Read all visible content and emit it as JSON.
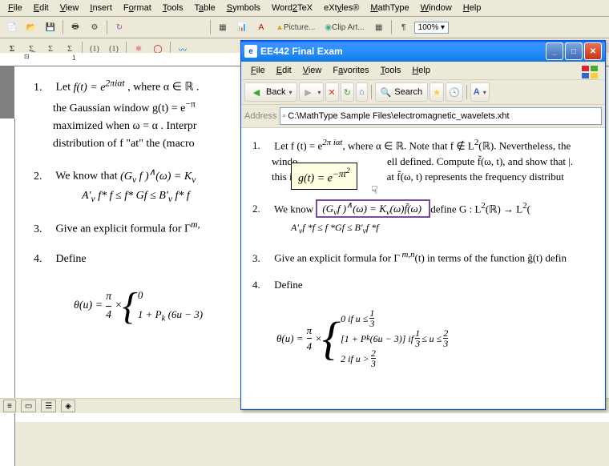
{
  "main_menu": {
    "file": "File",
    "edit": "Edit",
    "view": "View",
    "insert": "Insert",
    "format": "Format",
    "tools": "Tools",
    "table": "Table",
    "symbols": "Symbols",
    "word2tex": "Word2TeX",
    "extyles": "eXtyles",
    "mathtype": "MathType",
    "window": "Window",
    "help": "Help"
  },
  "main_toolbar": {
    "picture": "Picture...",
    "clipart": "Clip Art...",
    "zoom": "100%"
  },
  "doc": {
    "q1_num": "1.",
    "q1_text_a": "Let ",
    "q1_math_a": "f(t) = e",
    "q1_sup_a": "2πiαt",
    "q1_text_b": ", where α ∈ ℝ .",
    "q1_text_c": "the Gaussian window  g(t) = e",
    "q1_sup_c": "−π",
    "q1_text_d": "maximized when ω = α . Interpr",
    "q1_text_e": "distribution of  f  \"at\" the (macro",
    "q2_num": "2.",
    "q2_text_a": "We know that ",
    "q2_math_a": "(G",
    "q2_sub_a": "ν",
    "q2_math_b": " f )",
    "q2_sup_b": "∧",
    "q2_math_c": "(ω) = K",
    "q2_sub_c": "ν",
    "q2_line2": "A'",
    "q2_sub2": "ν",
    "q2_line2b": " f* f ≤ f* Gf ≤ B'",
    "q2_sub2c": "ν",
    "q2_line2c": " f* f",
    "q3_num": "3.",
    "q3_text": "Give an explicit formula for Γ",
    "q3_sup": "m,",
    "q4_num": "4.",
    "q4_text": "Define",
    "q4_eq_left": "θ(u) = ",
    "q4_eq_frac_num": "π",
    "q4_eq_frac_den": "4",
    "q4_eq_mid": " × ",
    "q4_eq_top": "0",
    "q4_eq_bot": "1 + P",
    "q4_eq_bot_sub": "k",
    "q4_eq_bot2": " (6u − 3)"
  },
  "popup": {
    "title": "EE442 Final Exam",
    "menu": {
      "file": "File",
      "edit": "Edit",
      "view": "View",
      "favorites": "Favorites",
      "tools": "Tools",
      "help": "Help"
    },
    "back": "Back",
    "search": "Search",
    "addr_label": "Address",
    "addr_value": "C:\\MathType Sample Files\\electromagnetic_wavelets.xht",
    "q1_num": "1.",
    "q1a": "Let f (t) = e",
    "q1sup": "2π iαt",
    "q1b": ", where α ∈ ℝ. Note that f ∉ L",
    "q1sup2": "2",
    "q1c": "(ℝ). Nevertheless, the ",
    "q1d": "windo",
    "q1e": "ell defined. Compute f̃(ω, t), and show that |.",
    "q1f": "this in",
    "q1g": "at f̃(ω, t) represents the frequency distribut",
    "tooltip": "g(t) = e",
    "tooltip_sup": "−πt",
    "tooltip_sup2": "2",
    "q2_num": "2.",
    "q2a": "We know",
    "q2hl": "(G",
    "q2hl_sub": "ν",
    "q2hl2": "f )",
    "q2hl_sup": "∧",
    "q2hl3": "(ω) = K",
    "q2hl_sub2": "ν",
    "q2hl4": "(ω)f̃(ω)",
    "q2b": " define G : L",
    "q2sup3": "2",
    "q2c": "(ℝ) → L",
    "q2sup4": "2",
    "q2d": "(",
    "q2line2": "A'",
    "q2l2sub": "ν",
    "q2l2b": "f *f ≤ f *Gf ≤ B'",
    "q2l2sub2": "ν",
    "q2l2c": "f *f",
    "q3_num": "3.",
    "q3a": "Give an explicit formula for Γ",
    "q3sup": " m,n",
    "q3b": "(t) in terms of the function g̃(t) defin",
    "q4_num": "4.",
    "q4a": "Define",
    "q4eq_left": "θ(u) = ",
    "q4eq_num": "π",
    "q4eq_den": "4",
    "q4eq_mid": " × ",
    "q4r1a": "0 if u ≤ ",
    "q4r1num": "1",
    "q4r1den": "3",
    "q4r2a": "[1 + P",
    "q4r2sub": "k",
    "q4r2b": "(6u − 3)] if ",
    "q4r2num1": "1",
    "q4r2den1": "3",
    "q4r2c": " ≤ u ≤ ",
    "q4r2num2": "2",
    "q4r2den2": "3",
    "q4r3a": "2 if u > ",
    "q4r3num": "2",
    "q4r3den": "3"
  }
}
